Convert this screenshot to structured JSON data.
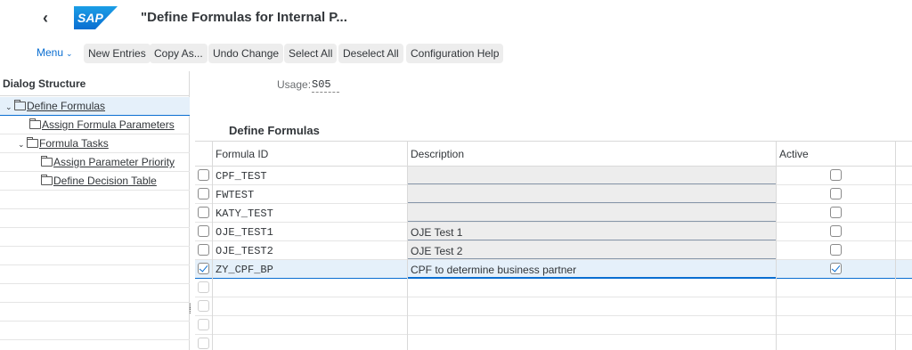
{
  "shell": {
    "title": "\"Define Formulas for Internal P...",
    "logo_text": "SAP"
  },
  "toolbar": {
    "menu_label": "Menu",
    "buttons": [
      "New Entries",
      "Copy As...",
      "Undo Change",
      "Select All",
      "Deselect All",
      "Configuration Help"
    ]
  },
  "tree": {
    "header": "Dialog Structure",
    "items": [
      {
        "label": "Define Formulas",
        "level": 0,
        "expanded": true,
        "selected": true
      },
      {
        "label": "Assign Formula Parameters",
        "level": 1
      },
      {
        "label": "Formula Tasks",
        "level": 1,
        "expanded": true
      },
      {
        "label": "Assign Parameter Priority",
        "level": 2
      },
      {
        "label": "Define Decision Table",
        "level": 2
      }
    ]
  },
  "usage": {
    "label": "Usage:",
    "value": "S05"
  },
  "table": {
    "title": "Define Formulas",
    "columns": [
      "Formula ID",
      "Description",
      "Active"
    ],
    "rows": [
      {
        "id": "CPF_TEST",
        "description": "",
        "active": false,
        "selected": false
      },
      {
        "id": "FWTEST",
        "description": "",
        "active": false,
        "selected": false
      },
      {
        "id": "KATY_TEST",
        "description": "",
        "active": false,
        "selected": false
      },
      {
        "id": "OJE_TEST1",
        "description": "OJE Test 1",
        "active": false,
        "selected": false
      },
      {
        "id": "OJE_TEST2",
        "description": "OJE Test 2",
        "active": false,
        "selected": false
      },
      {
        "id": "ZY_CPF_BP",
        "description": "CPF to determine business partner",
        "active": true,
        "selected": true
      }
    ],
    "empty_rows": 4
  },
  "colors": {
    "accent": "#0a6ed1",
    "logo_blue": "#0a6ed1",
    "selection": "#e5f0fa"
  }
}
